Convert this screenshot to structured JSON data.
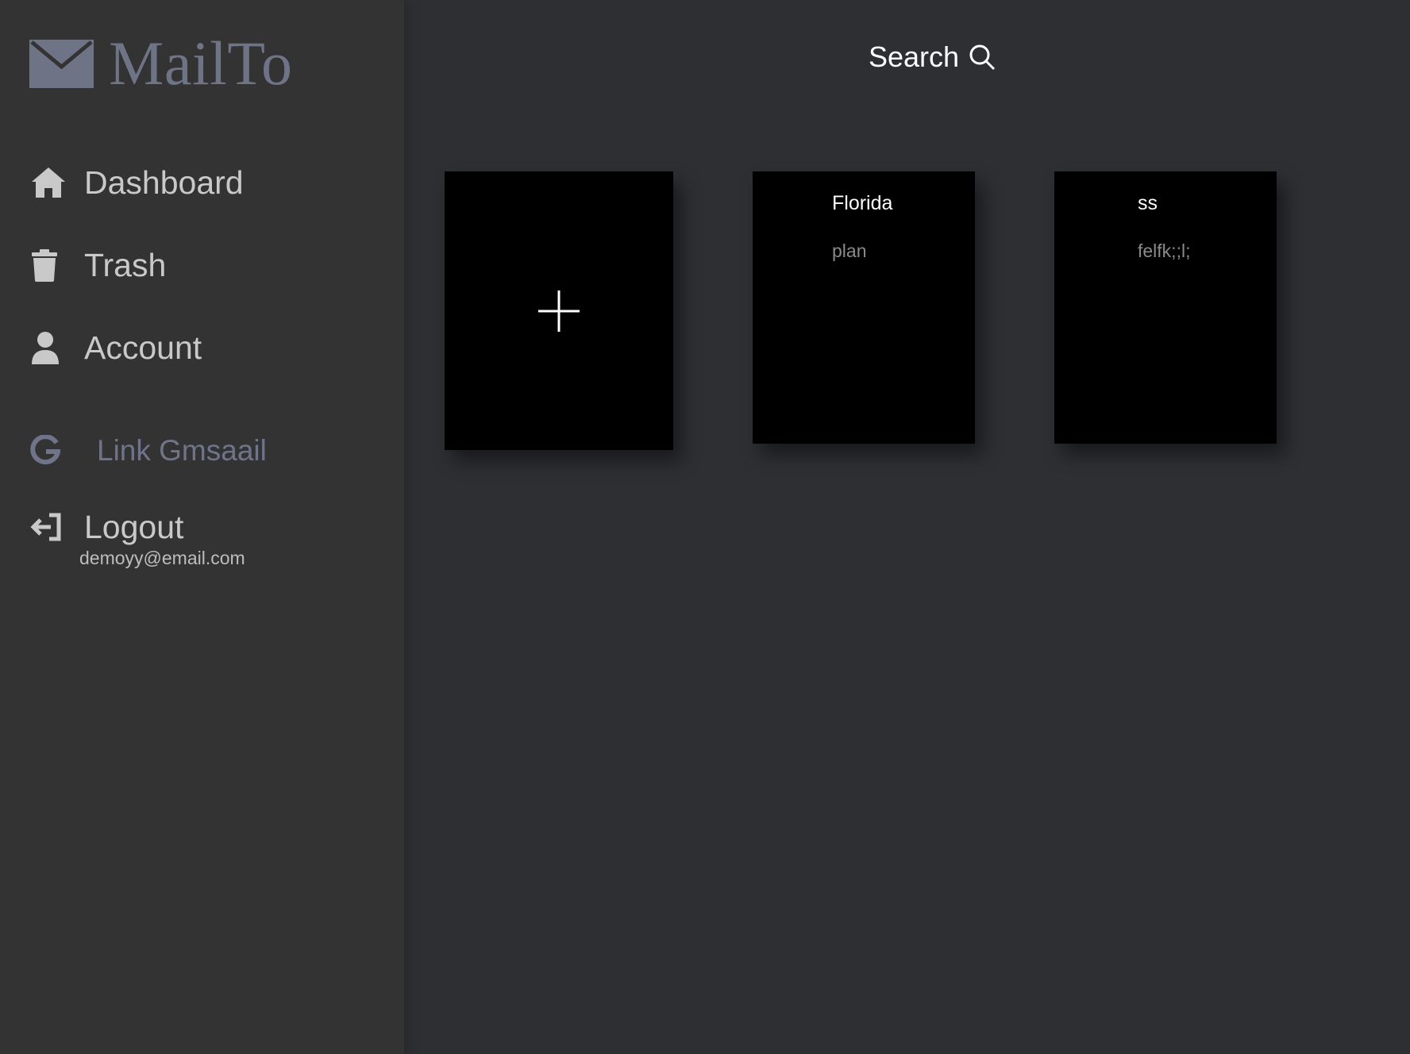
{
  "brand": {
    "name": "MailTo",
    "icon": "envelope-icon"
  },
  "sidebar": {
    "items": [
      {
        "label": "Dashboard",
        "icon": "home-icon"
      },
      {
        "label": "Trash",
        "icon": "trash-icon"
      },
      {
        "label": "Account",
        "icon": "user-icon"
      },
      {
        "label": "Link Gmsaail",
        "icon": "google-icon"
      },
      {
        "label": "Logout",
        "icon": "logout-icon"
      }
    ],
    "user_email": "demoyy@email.com"
  },
  "header": {
    "search_label": "Search",
    "search_icon": "search-icon"
  },
  "notes": {
    "new_note_icon": "plus-icon",
    "items": [
      {
        "title": "Florida",
        "body": "plan"
      },
      {
        "title": "ss",
        "body": "felfk;;l;"
      }
    ]
  },
  "colors": {
    "main_background": "#2e2f33",
    "sidebar_background": "#333333",
    "card_background": "#000000",
    "brand_color": "#6f7386",
    "muted_link": "#70748a"
  }
}
